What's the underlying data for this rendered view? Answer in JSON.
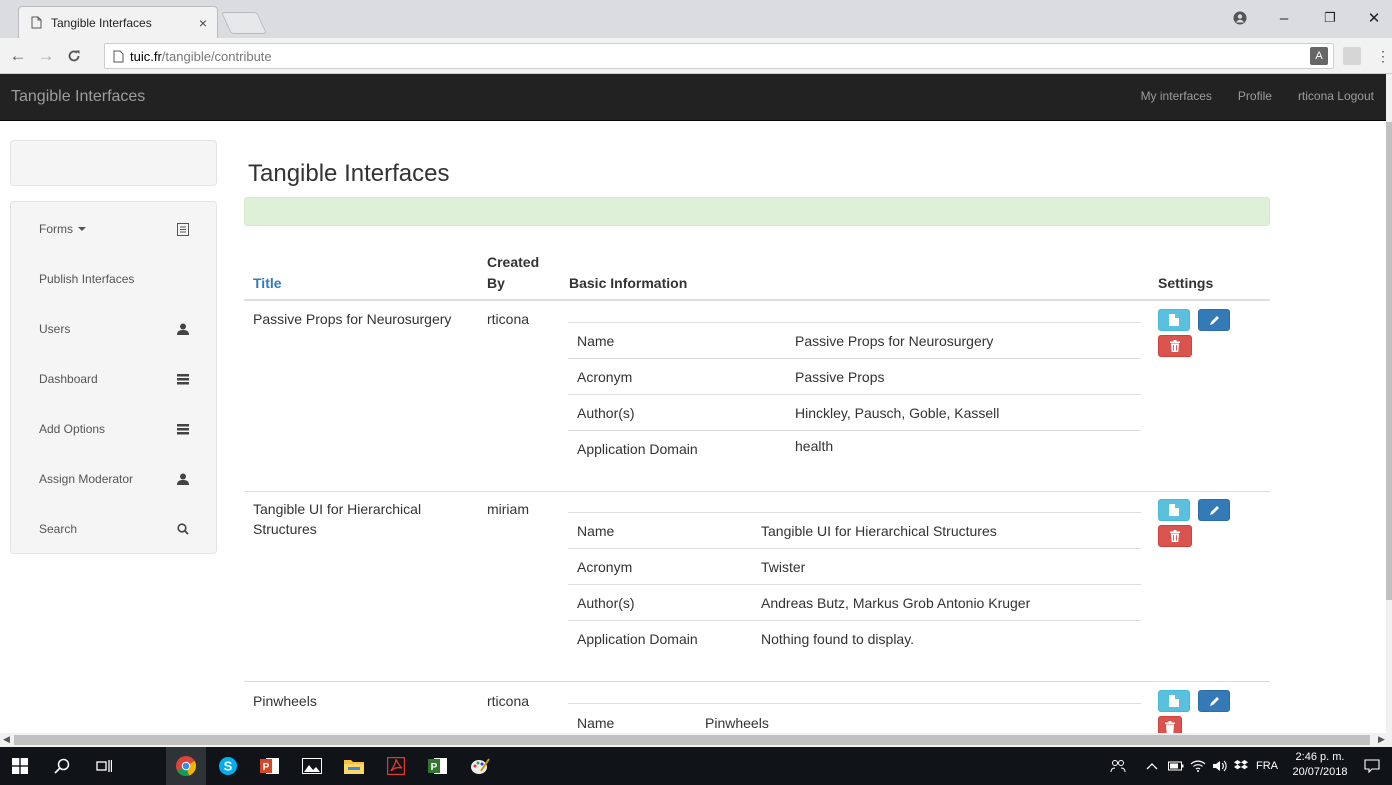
{
  "browser": {
    "tab_title": "Tangible Interfaces",
    "tab_close": "×",
    "url_host": "tuic.fr",
    "url_path": "/tangible/contribute",
    "window_controls": [
      "–",
      "❐",
      "✕"
    ]
  },
  "navbar": {
    "brand": "Tangible Interfaces",
    "links": [
      "My interfaces",
      "Profile",
      "rticona Logout"
    ]
  },
  "sidebar": {
    "items": [
      {
        "label": "Forms",
        "icon": "list-icon",
        "dropdown": true
      },
      {
        "label": "Publish Interfaces",
        "icon": ""
      },
      {
        "label": "Users",
        "icon": "user-icon"
      },
      {
        "label": "Dashboard",
        "icon": "tasks-icon"
      },
      {
        "label": "Add Options",
        "icon": "tasks-icon"
      },
      {
        "label": "Assign Moderator",
        "icon": "user-icon"
      },
      {
        "label": "Search",
        "icon": "search-icon"
      }
    ]
  },
  "main": {
    "title": "Tangible Interfaces",
    "table": {
      "headers": {
        "title": "Title",
        "created_by": "Created By",
        "created_by_1": "Created",
        "created_by_2": "By",
        "basic_information": "Basic Information",
        "settings": "Settings"
      },
      "rows": [
        {
          "title": "Passive Props for Neurosurgery",
          "created_by": "rticona",
          "info": [
            {
              "label": "Name",
              "value": "Passive Props for Neurosurgery"
            },
            {
              "label": "Acronym",
              "value": "Passive Props"
            },
            {
              "label": "Author(s)",
              "value": "Hinckley, Pausch, Goble, Kassell"
            },
            {
              "label": "Application Domain",
              "value": "health"
            }
          ]
        },
        {
          "title": "Tangible UI for Hierarchical Structures",
          "title_1": "Tangible UI for Hierarchical",
          "title_2": "Structures",
          "created_by": "miriam",
          "info": [
            {
              "label": "Name",
              "value": "Tangible UI for Hierarchical Structures"
            },
            {
              "label": "Acronym",
              "value": "Twister"
            },
            {
              "label": "Author(s)",
              "value": "Andreas Butz, Markus Grob Antonio Kruger"
            },
            {
              "label": "Application Domain",
              "value": "Nothing found to display."
            }
          ]
        },
        {
          "title": "Pinwheels",
          "created_by": "rticona",
          "info": [
            {
              "label": "Name",
              "value": "Pinwheels"
            }
          ]
        }
      ]
    }
  },
  "taskbar": {
    "language": "FRA",
    "time": "2:46 p. m.",
    "date": "20/07/2018"
  },
  "colors": {
    "navbar_bg": "#222222",
    "link": "#337ab7",
    "alert_success": "#dff0d8",
    "btn_info": "#5bc0de",
    "btn_primary": "#337ab7",
    "btn_danger": "#d9534f"
  }
}
